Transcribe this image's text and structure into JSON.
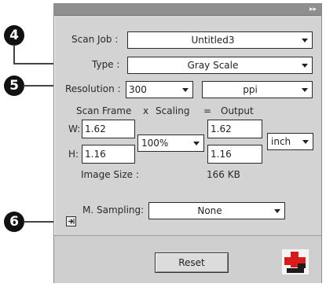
{
  "panel": {
    "scan_job_label": "Scan Job :",
    "scan_job_value": "Untitled3",
    "type_label": "Type :",
    "type_value": "Gray Scale",
    "resolution_label": "Resolution :",
    "resolution_value": "300",
    "resolution_unit": "ppi",
    "scan_frame_header": "Scan Frame",
    "x_label": "x",
    "scaling_header": "Scaling",
    "equals_label": "=",
    "output_header": "Output",
    "w_label": "W:",
    "w_value": "1.62",
    "h_label": "H:",
    "h_value": "1.16",
    "scaling_value": "100%",
    "output_w_value": "1.62",
    "output_h_value": "1.16",
    "output_unit": "inch",
    "image_size_label": "Image Size :",
    "image_size_value": "166 KB",
    "sampling_label": "M. Sampling:",
    "sampling_value": "None",
    "reset_label": "Reset"
  },
  "callouts": {
    "c4": "4",
    "c5": "5",
    "c6": "6"
  },
  "colors": {
    "panel": "#d3d3d3",
    "logo_red": "#d81b1b"
  }
}
